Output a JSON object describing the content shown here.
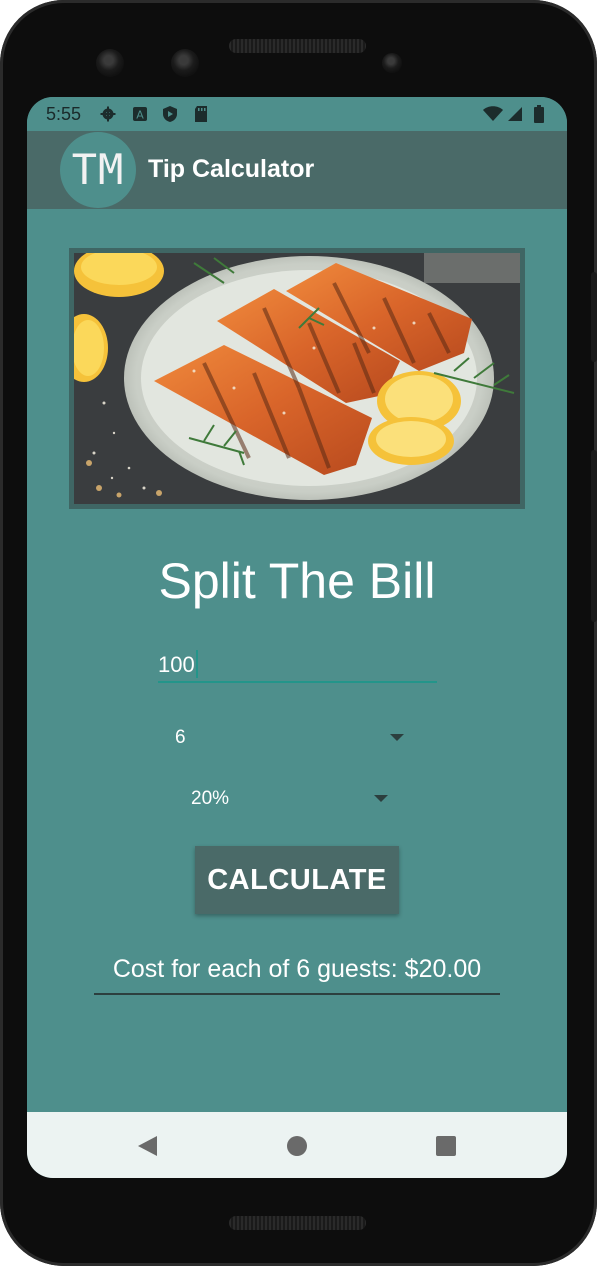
{
  "status_bar": {
    "time": "5:55",
    "left_icons": [
      "gear-icon",
      "a-badge-icon",
      "play-shield-icon",
      "sd-card-icon"
    ],
    "right_icons": [
      "wifi-icon",
      "signal-icon",
      "battery-icon"
    ]
  },
  "app_bar": {
    "logo_text": "TM",
    "title": "Tip Calculator"
  },
  "hero_image": {
    "subject": "grilled salmon fillets with lemon slices and dill on a plate"
  },
  "main": {
    "heading": "Split The Bill",
    "amount_value": "100",
    "guests_value": "6",
    "tip_value": "20%",
    "calculate_label": "CALCULATE",
    "result_text": "Cost for each of 6 guests: $20.00"
  },
  "nav_bar": {
    "icons": [
      "back-icon",
      "home-icon",
      "recents-icon"
    ]
  },
  "colors": {
    "screen_bg": "#4e8f8c",
    "app_bar_bg": "#4a6a68",
    "accent_underline": "#23958a",
    "text": "#ffffff"
  }
}
